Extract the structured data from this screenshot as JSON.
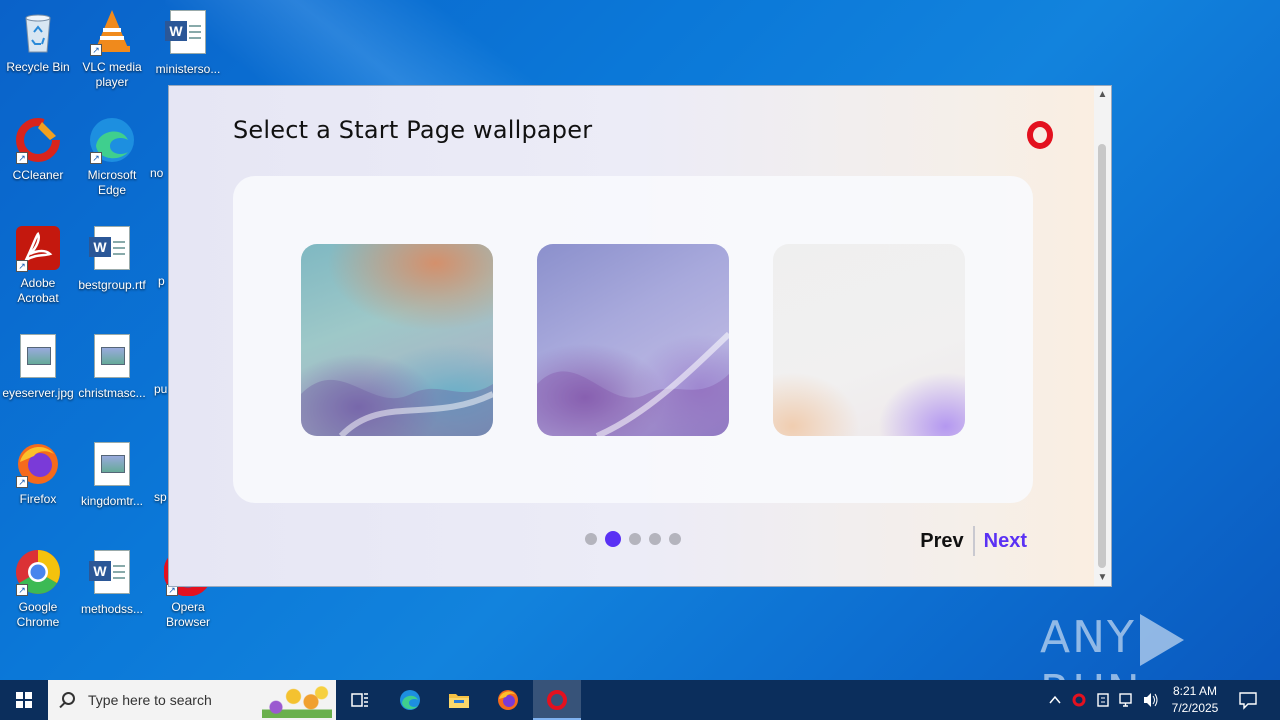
{
  "desktop": {
    "icons": [
      {
        "label": "Recycle Bin"
      },
      {
        "label": "VLC media player"
      },
      {
        "label": "ministerso..."
      },
      {
        "label": "CCleaner"
      },
      {
        "label": "Microsoft Edge"
      },
      {
        "label": "no"
      },
      {
        "label": "Adobe Acrobat"
      },
      {
        "label": "bestgroup.rtf"
      },
      {
        "label": "p"
      },
      {
        "label": "eyeserver.jpg"
      },
      {
        "label": "christmasc..."
      },
      {
        "label": "pu"
      },
      {
        "label": "Firefox"
      },
      {
        "label": "kingdomtr..."
      },
      {
        "label": "sp"
      },
      {
        "label": "Google Chrome"
      },
      {
        "label": "methodss..."
      },
      {
        "label": "Opera Browser"
      }
    ]
  },
  "dialog": {
    "title": "Select a Start Page wallpaper",
    "logo_icon": "opera-logo-icon",
    "wallpapers": [
      {
        "name": "wallpaper-1"
      },
      {
        "name": "wallpaper-2"
      },
      {
        "name": "wallpaper-3"
      }
    ],
    "pagination": {
      "total": 5,
      "active": 2
    },
    "prev_label": "Prev",
    "next_label": "Next",
    "accent_color": "#5a31f4"
  },
  "watermark": {
    "text_left": "ANY",
    "text_right": "RUN"
  },
  "taskbar": {
    "search_placeholder": "Type here to search",
    "apps": [
      "task-view-icon",
      "edge-icon",
      "file-explorer-icon",
      "firefox-icon",
      "opera-icon"
    ],
    "clock_time": "8:21 AM",
    "clock_date": "7/2/2025"
  }
}
